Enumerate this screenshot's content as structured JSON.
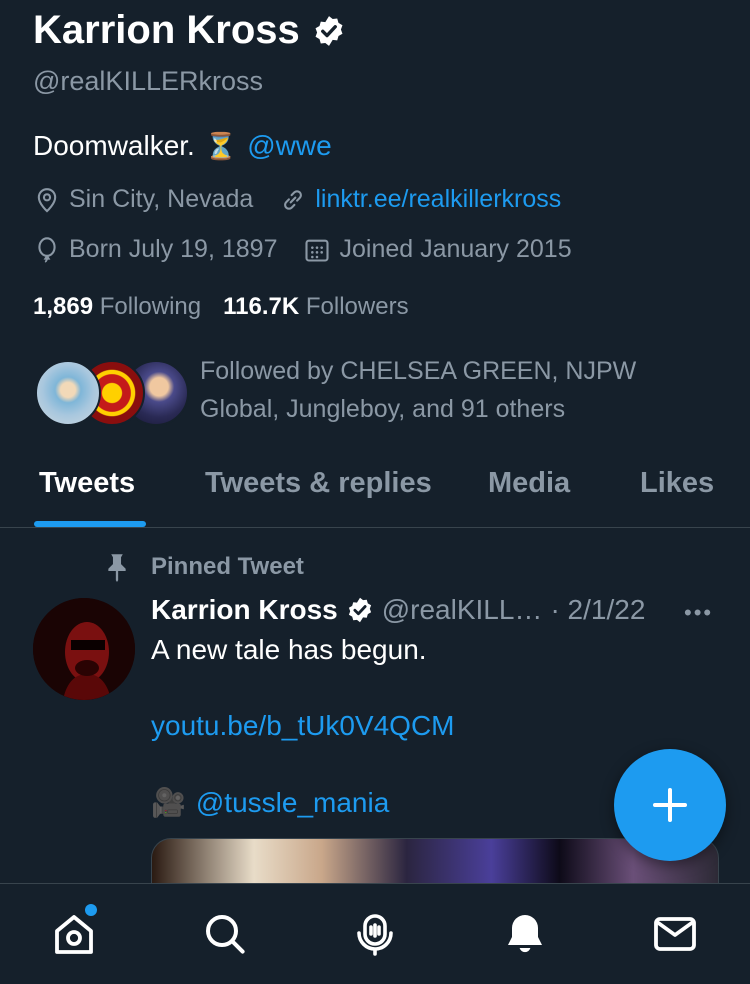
{
  "profile": {
    "name": "Karrion Kross",
    "handle": "@realKILLERkross",
    "bio_text": "Doomwalker.",
    "bio_emoji": "⏳",
    "bio_mention": "@wwe",
    "location": "Sin City, Nevada",
    "website": "linktr.ee/realkillerkross",
    "birthday": "Born July 19, 1897",
    "joined": "Joined January 2015",
    "following_count": "1,869",
    "following_label": "Following",
    "followers_count": "116.7K",
    "followers_label": "Followers",
    "followed_by": "Followed by CHELSEA GREEN, NJPW Global, Jungleboy, and 91 others"
  },
  "tabs": [
    {
      "label": "Tweets",
      "active": true
    },
    {
      "label": "Tweets & replies",
      "active": false
    },
    {
      "label": "Media",
      "active": false
    },
    {
      "label": "Likes",
      "active": false
    }
  ],
  "pinned_tweet": {
    "pinned_label": "Pinned Tweet",
    "author_name": "Karrion Kross",
    "author_handle": "@realKILL…",
    "date": "· 2/1/22",
    "more": "•••",
    "text": "A new tale has begun.",
    "link": "youtu.be/b_tUk0V4QCM",
    "camera_emoji": "🎥",
    "mention": "@tussle_mania"
  },
  "icons": {
    "verified": "verified-badge-icon",
    "location": "location-pin-icon",
    "link": "link-icon",
    "birthday": "balloon-icon",
    "calendar": "calendar-icon",
    "pin": "pin-icon",
    "compose": "plus-icon",
    "home": "home-icon",
    "search": "search-icon",
    "spaces": "microphone-icon",
    "notifications": "bell-icon",
    "messages": "mail-icon"
  },
  "colors": {
    "background": "#15202b",
    "accent": "#1d9bf0",
    "secondary_text": "#8b98a5",
    "divider": "#38444d"
  }
}
